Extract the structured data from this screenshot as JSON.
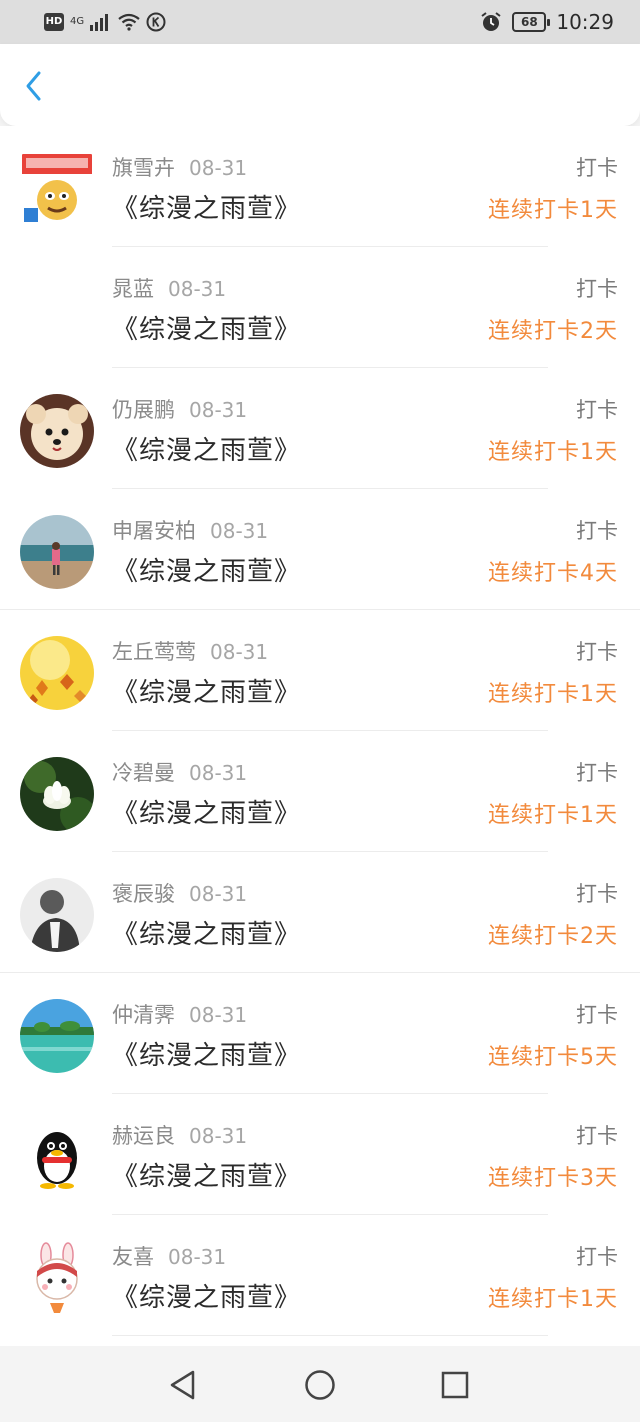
{
  "status_bar": {
    "left_badge": "HD",
    "network": "4G",
    "battery": "68",
    "time": "10:29"
  },
  "colors": {
    "accent": "#2f9ee5",
    "streak": "#f28a3c"
  },
  "entries": [
    {
      "name": "旗雪卉",
      "date": "08-31",
      "book": "《综漫之雨萱》",
      "action": "打卡",
      "streak": "连续打卡1天",
      "avatar": "anime-avatar"
    },
    {
      "name": "晁蓝",
      "date": "08-31",
      "book": "《综漫之雨萱》",
      "action": "打卡",
      "streak": "连续打卡2天",
      "avatar": ""
    },
    {
      "name": "仍展鹏",
      "date": "08-31",
      "book": "《综漫之雨萱》",
      "action": "打卡",
      "streak": "连续打卡1天",
      "avatar": "dog-avatar"
    },
    {
      "name": "申屠安柏",
      "date": "08-31",
      "book": "《综漫之雨萱》",
      "action": "打卡",
      "streak": "连续打卡4天",
      "avatar": "beach-avatar"
    },
    {
      "name": "左丘莺莺",
      "date": "08-31",
      "book": "《综漫之雨萱》",
      "action": "打卡",
      "streak": "连续打卡1天",
      "avatar": "autumn-leaves-avatar"
    },
    {
      "name": "冷碧曼",
      "date": "08-31",
      "book": "《综漫之雨萱》",
      "action": "打卡",
      "streak": "连续打卡1天",
      "avatar": "lotus-avatar"
    },
    {
      "name": "褒辰骏",
      "date": "08-31",
      "book": "《综漫之雨萱》",
      "action": "打卡",
      "streak": "连续打卡2天",
      "avatar": "man-portrait-avatar"
    },
    {
      "name": "仲清霁",
      "date": "08-31",
      "book": "《综漫之雨萱》",
      "action": "打卡",
      "streak": "连续打卡5天",
      "avatar": "island-avatar"
    },
    {
      "name": "赫运良",
      "date": "08-31",
      "book": "《综漫之雨萱》",
      "action": "打卡",
      "streak": "连续打卡3天",
      "avatar": "penguin-avatar"
    },
    {
      "name": "友喜",
      "date": "08-31",
      "book": "《综漫之雨萱》",
      "action": "打卡",
      "streak": "连续打卡1天",
      "avatar": "bunny-avatar"
    }
  ]
}
